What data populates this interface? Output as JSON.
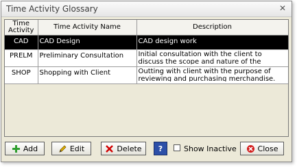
{
  "window": {
    "title": "Time Activity Glossary",
    "close_glyph": "✕"
  },
  "grid": {
    "columns": [
      "Time Activity",
      "Time Activity Name",
      "Description"
    ],
    "rows": [
      {
        "code": "CAD",
        "name": "CAD Design",
        "description": "CAD design work"
      },
      {
        "code": "PRELM",
        "name": "Preliminary Consultation",
        "description": "Initial consultation with the client to discuss the scope and nature of the project."
      },
      {
        "code": "SHOP",
        "name": "Shopping with Client",
        "description": "Outting with client with the purpose of reviewing and purchasing merchandise."
      }
    ]
  },
  "toolbar": {
    "add_label": "Add",
    "edit_label": "Edit",
    "delete_label": "Delete",
    "help_glyph": "?",
    "show_inactive_label": "Show Inactive",
    "close_label": "Close"
  },
  "colors": {
    "selection_bg": "#000000",
    "window_bg": "#ece9d8"
  }
}
